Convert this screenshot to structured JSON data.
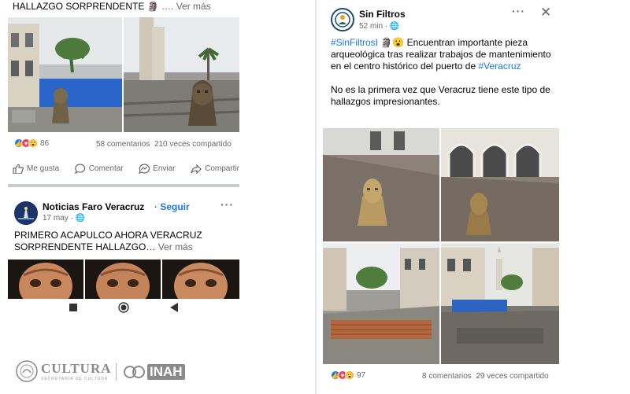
{
  "left_post_top": {
    "caption": "HALLAZGO SORPRENDENTE",
    "more": "Ver más",
    "reactions_count": "86",
    "comments": "58 comentarios",
    "shares": "210 veces compartido",
    "actions": [
      "Me gusta",
      "Comentar",
      "Enviar",
      "Compartir"
    ]
  },
  "left_post_bottom": {
    "page_name": "Noticias Faro Veracruz",
    "follow": "Seguir",
    "date": "17 may",
    "text": "PRIMERO ACAPULCO AHORA VERACRUZ",
    "text2": "SORPRENDENTE HALLAZGO…",
    "more": "Ver más"
  },
  "android_nav": [
    "square-button",
    "home-button",
    "back-button"
  ],
  "footer_logos": {
    "cultura": "CULTURA",
    "cultura_sub": "SECRETARÍA DE CULTURA",
    "inah": "INAH"
  },
  "right_post": {
    "page_name": "Sin Filtros",
    "time": "52 min",
    "hashtag": "#SinFiltrosI",
    "text": "Encuentran importante pieza arqueológica tras realizar trabajos de mantenimiento en el centro histórico del puerto de",
    "hashtag2": "#Veracruz",
    "text2": "No es la primera vez que Veracruz tiene este tipo de hallazgos impresionantes.",
    "reactions_count": "97",
    "comments": "8 comentarios",
    "shares": "29 veces compartido"
  },
  "colors": {
    "link": "#1877f2",
    "muted": "#65676b",
    "like": "#1877f2",
    "love": "#f33e58",
    "wow": "#f7b125"
  }
}
